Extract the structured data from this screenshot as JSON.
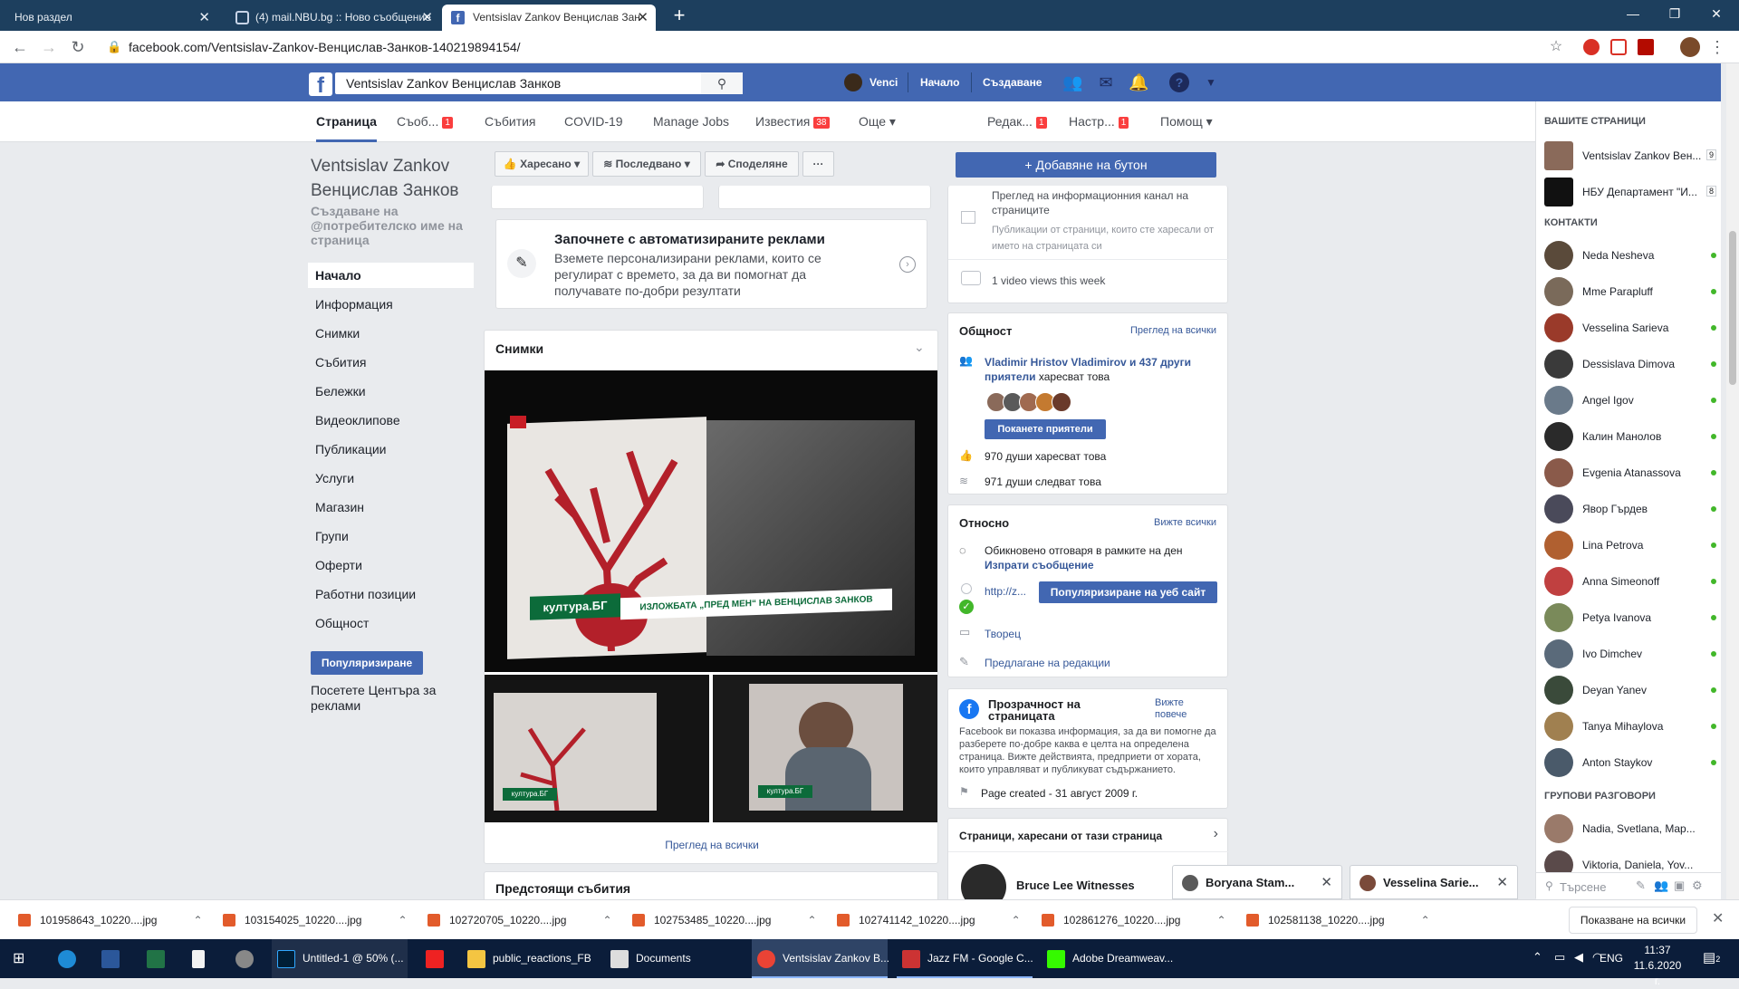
{
  "browser": {
    "tabs": [
      {
        "title": "Нов раздел"
      },
      {
        "title": "(4) mail.NBU.bg :: Ново съобщение"
      },
      {
        "title": "Ventsislav Zankov Венцислав Зан"
      }
    ],
    "url": "facebook.com/Ventsislav-Zankov-Венцислав-Занков-140219894154/"
  },
  "fb_header": {
    "search_value": "Ventsislav Zankov Венцислав Занков",
    "user": "Venci",
    "home": "Начало",
    "create": "Създаване"
  },
  "page_tabs": [
    {
      "label": "Страница"
    },
    {
      "label": "Съоб...",
      "badge": "1"
    },
    {
      "label": "Събития"
    },
    {
      "label": "COVID-19"
    },
    {
      "label": "Manage Jobs"
    },
    {
      "label": "Известия",
      "badge": "38"
    },
    {
      "label": "Още ▾"
    },
    {
      "label": "Редак...",
      "badge": "1"
    },
    {
      "label": "Настр...",
      "badge": "1"
    },
    {
      "label": "Помощ ▾"
    }
  ],
  "left": {
    "page_name": "Ventsislav Zankov Венцислав Занков",
    "username_prompt": "Създаване на @потребителско име на страница",
    "nav": [
      "Начало",
      "Информация",
      "Снимки",
      "Събития",
      "Бележки",
      "Видеоклипове",
      "Публикации",
      "Услуги",
      "Магазин",
      "Групи",
      "Оферти",
      "Работни позиции",
      "Общност"
    ],
    "promote": "Популяризиране",
    "ad_center": "Посетете Центъра за реклами"
  },
  "actions": {
    "liked": "Харесано",
    "following": "Последвано",
    "share": "Споделяне",
    "more": "···",
    "add_button": "+ Добавяне на бутон"
  },
  "ads_card": {
    "title": "Започнете с автоматизираните реклами",
    "text": "Вземете персонализирани реклами, които се регулират с времето, за да ви помогнат да получавате по-добри резултати"
  },
  "photos": {
    "title": "Снимки",
    "caption_tv": "култура.БГ",
    "caption_line": "ИЗЛОЖБАТА „ПРЕД МЕН“ НА ВЕНЦИСЛАВ ЗАНКОВ",
    "view_all": "Преглед на всички"
  },
  "upcoming": {
    "title": "Предстоящи събития"
  },
  "insights": {
    "feed_title": "Преглед на информационния канал на страниците",
    "feed_sub": "Публикации от страници, които сте харесали от името на страницата си",
    "video_views": "1 video views this week"
  },
  "community": {
    "title": "Общност",
    "see_all": "Преглед на всички",
    "friends_link": "Vladimir Hristov Vladimirov и 437 други приятели",
    "friends_suffix": "харесват това",
    "invite": "Поканете приятели",
    "likes": "970 души харесват това",
    "follows": "971 души следват това"
  },
  "about": {
    "title": "Относно",
    "see_all": "Вижте всички",
    "response": "Обикновено отговаря в рамките на ден",
    "send_message": "Изпрати съобщение",
    "website": "http://z...",
    "promote_site": "Популяризиране на уеб сайт",
    "category": "Творец",
    "suggest": "Предлагане на редакции"
  },
  "transparency": {
    "title": "Прозрачност на страницата",
    "see_more": "Вижте повече",
    "text": "Facebook ви показва информация, за да ви помогне да разберете по-добре каква е целта на определена страница. Вижте действията, предприети от хората, които управляват и публикуват съдържанието.",
    "created": "Page created - 31 август 2009 г."
  },
  "liked_pages": {
    "title": "Страници, харесани от тази страница",
    "first": "Bruce Lee Witnesses"
  },
  "sidebar": {
    "your_pages": "ВАШИТЕ СТРАНИЦИ",
    "pages": [
      {
        "name": "Ventsislav Zankov Вен...",
        "count": "9"
      },
      {
        "name": "НБУ Департамент \"И...",
        "count": "8"
      }
    ],
    "contacts_title": "КОНТАКТИ",
    "contacts": [
      "Neda Nesheva",
      "Mme Parapluff",
      "Vesselina Sarieva",
      "Dessislava Dimova",
      "Angel Igov",
      "Калин Манолов",
      "Evgenia Atanassova",
      "Явор Гърдев",
      "Lina Petrova",
      "Anna Simeonoff",
      "Petya Ivanova",
      "Ivo Dimchev",
      "Deyan Yanev",
      "Tanya Mihaylova",
      "Anton Staykov"
    ],
    "groups_title": "ГРУПОВИ РАЗГОВОРИ",
    "groups": [
      "Nadia, Svetlana, Map...",
      "Viktoria, Daniela, Yov..."
    ],
    "search_placeholder": "Търсене"
  },
  "chat_popups": [
    "Boryana Stam...",
    "Vesselina Sarie..."
  ],
  "downloads": {
    "files": [
      "101958643_10220....jpg",
      "103154025_10220....jpg",
      "102720705_10220....jpg",
      "102753485_10220....jpg",
      "102741142_10220....jpg",
      "102861276_10220....jpg",
      "102581138_10220....jpg"
    ],
    "show_all": "Показване на всички"
  },
  "taskbar": {
    "apps": [
      "Untitled-1 @ 50% (...",
      "public_reactions_FB",
      "Documents",
      "Ventsislav Zankov B...",
      "Jazz FM - Google C...",
      "Adobe Dreamweav..."
    ],
    "lang": "ENG",
    "time": "11:37",
    "date": "11.6.2020 г.",
    "notif_count": "2"
  }
}
